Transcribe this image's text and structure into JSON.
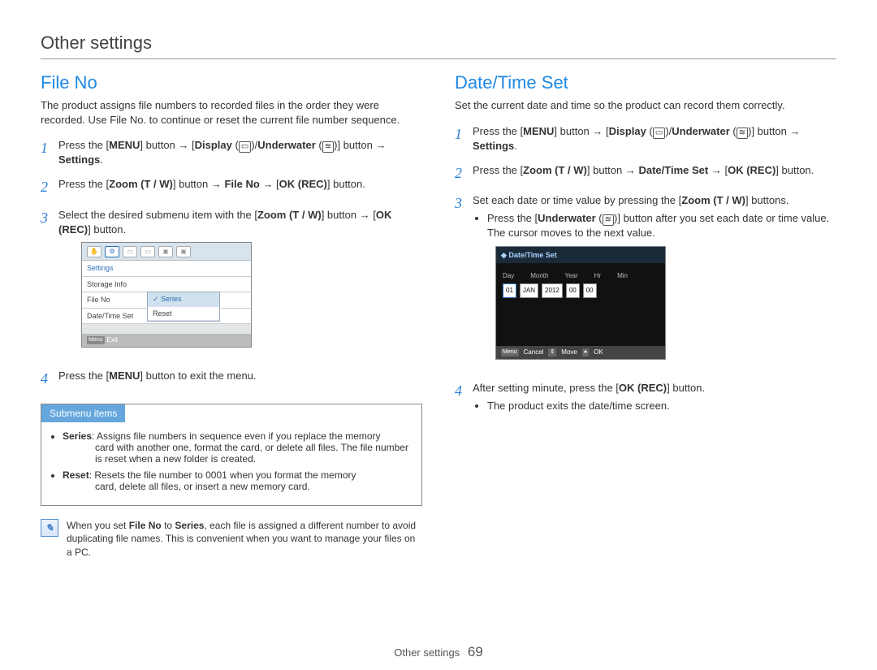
{
  "page": {
    "header": "Other settings",
    "footer_label": "Other settings",
    "page_number": "69"
  },
  "left": {
    "title": "File No",
    "intro": "The product assigns file numbers to recorded files in the order they were recorded. Use File No. to continue or reset the current file number sequence.",
    "steps": {
      "s1_a": "Press the [",
      "s1_menu": "MENU",
      "s1_b": "] button ",
      "s1_to": " [",
      "s1_disp": "Display",
      "s1_slash": " (",
      "s1_dispicon": "▭",
      "s1_c": ")/",
      "s1_under": "Underwater",
      "s1_undericon": "≋",
      "s1_d": " (",
      "s1_e": ")] button ",
      "s1_settings": "Settings",
      "s1_f": ".",
      "s2_a": "Press the [",
      "s2_zoom": "Zoom",
      "s2_tw": " (T / W)",
      "s2_b": "] button ",
      "s2_file": "File No",
      "s2_c": " [",
      "s2_okrec": "OK (REC)",
      "s2_d": "] button.",
      "s3_a": "Select the desired submenu item with the [",
      "s3_zoom": "Zoom",
      "s3_tw": " (T / W)",
      "s3_b": "] button ",
      "s3_c": " [",
      "s3_okrec": "OK (REC)",
      "s3_d": "] button.",
      "s4_a": "Press the [",
      "s4_menu": "MENU",
      "s4_b": "] button to exit the menu."
    },
    "lcd": {
      "tab_settings": "Settings",
      "row_storage": "Storage Info",
      "row_fileno": "File No",
      "row_datetime": "Date/Time Set",
      "sub_series": "Series",
      "sub_reset": "Reset",
      "exit_key": "Menu",
      "exit_label": "Exit"
    },
    "submenu": {
      "title": "Submenu items",
      "series_term": "Series",
      "series_def1": ": Assigns file numbers in sequence even if you replace the memory",
      "series_def2": "card with another one, format the card, or delete all files. The file number is reset when a new folder is created.",
      "reset_term": "Reset",
      "reset_def1": ": Resets the file number to 0001 when you format the memory",
      "reset_def2": "card, delete all files, or insert a new memory card."
    },
    "note": {
      "text_a": "When you set ",
      "text_fileno": "File No",
      "text_b": " to ",
      "text_series": "Series",
      "text_c": ", each file is assigned a different number to avoid duplicating file names. This is convenient when you want to manage your files on a PC."
    }
  },
  "right": {
    "title": "Date/Time Set",
    "intro": "Set the current date and time so the product can record them correctly.",
    "steps": {
      "s1_a": "Press the [",
      "s1_menu": "MENU",
      "s1_b": "] button ",
      "s1_to": " [",
      "s1_disp": "Display",
      "s1_dispicon": "▭",
      "s1_c": " (",
      "s1_d": ")/",
      "s1_under": "Underwater",
      "s1_undericon": "≋",
      "s1_e": " (",
      "s1_f": ")] button ",
      "s1_settings": "Settings",
      "s1_g": ".",
      "s2_a": "Press the [",
      "s2_zoom": "Zoom",
      "s2_tw": " (T / W)",
      "s2_b": "] button ",
      "s2_dts": "Date/Time Set",
      "s2_c": " [",
      "s2_okrec": "OK (REC)",
      "s2_d": "] button.",
      "s3_a": "Set each date or time value by pressing the [",
      "s3_zoom": "Zoom",
      "s3_tw": " (T / W)",
      "s3_b": "] buttons.",
      "s3_bul_a": "Press the [",
      "s3_bul_under": "Underwater",
      "s3_bul_ui": "≋",
      "s3_bul_b": " (",
      "s3_bul_c": ")] button after you set each date or time value. The cursor moves to the next value.",
      "s4_a": "After setting minute, press the [",
      "s4_okrec": "OK (REC)",
      "s4_b": "] button.",
      "s4_bul": "The product exits the date/time screen."
    },
    "lcd": {
      "title": "Date/Time Set",
      "h_day": "Day",
      "h_month": "Month",
      "h_year": "Year",
      "h_hr": "Hr",
      "h_min": "Min",
      "v_day": "01",
      "v_month": "JAN",
      "v_year": "2012",
      "v_hr": "00",
      "v_min": "00",
      "f_menu": "Menu",
      "f_cancel": "Cancel",
      "f_move_icon": "⇕",
      "f_move": "Move",
      "f_ok_icon": "●",
      "f_ok": "OK"
    }
  }
}
